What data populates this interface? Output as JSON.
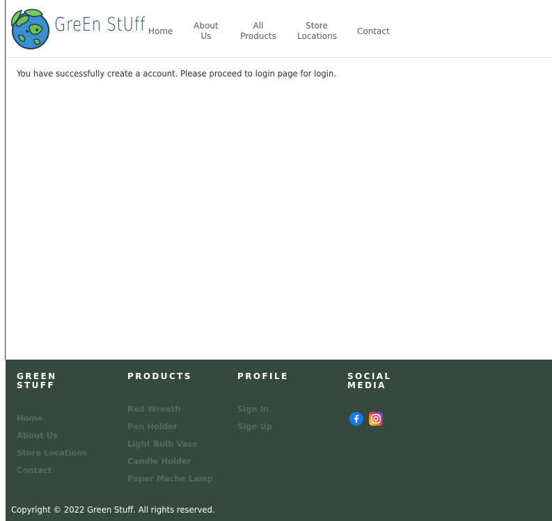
{
  "brand": {
    "name": "GreEn StUff",
    "logo_icon": "earth-globe-icon"
  },
  "nav": {
    "home": "Home",
    "about_line1": "About",
    "about_line2": "Us",
    "products_line1": "All",
    "products_line2": "Products",
    "stores_line1": "Store",
    "stores_line2": "Locations",
    "contact": "Contact"
  },
  "main": {
    "message": "You have successfully create a account. Please proceed to login page for login."
  },
  "footer": {
    "background": "#354a3c",
    "link_color": "#54695b",
    "green_stuff": {
      "heading": "GREEN STUFF",
      "links": [
        "Home",
        "About Us",
        "Store Locations",
        "Contact"
      ]
    },
    "products": {
      "heading": "PRODUCTS",
      "links": [
        "Red Wreath",
        "Pen Holder",
        "Light Bulb Vase",
        "Candle Holder",
        "Paper Mache Lamp"
      ]
    },
    "profile": {
      "heading": "PROFILE",
      "links": [
        "Sign In",
        "Sign Up"
      ]
    },
    "social": {
      "heading_line1": "SOCIAL",
      "heading_line2": "MEDIA",
      "icons": [
        "facebook-icon",
        "instagram-icon"
      ]
    },
    "copyright": "Copyright © 2022 Green Stuff. All rights reserved."
  }
}
